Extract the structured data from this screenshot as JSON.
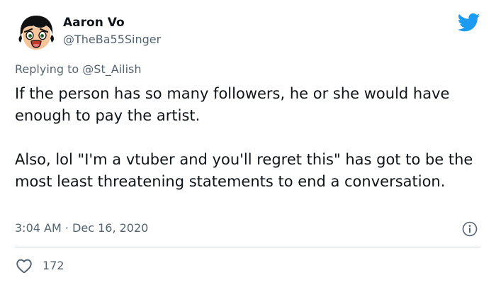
{
  "author": {
    "display_name": "Aaron Vo",
    "handle": "@TheBa55Singer"
  },
  "reply": {
    "prefix": "Replying to ",
    "mention": "@St_Ailish"
  },
  "tweet": {
    "paragraphs": [
      "If the person has so many followers, he or she would have enough to pay the artist.",
      "Also, lol \"I'm a vtuber and you'll regret this\" has got to be the most least threatening statements to end a conversation."
    ]
  },
  "meta": {
    "time": "3:04 AM",
    "separator": " · ",
    "date": "Dec 16, 2020"
  },
  "engagement": {
    "likes": "172"
  },
  "colors": {
    "brand": "#1d9bf0",
    "text_primary": "#0f1419",
    "text_secondary": "#536471",
    "divider": "#cfd9de"
  },
  "icons": {
    "logo": "twitter-bird-icon",
    "info": "info-icon",
    "like": "heart-icon"
  }
}
